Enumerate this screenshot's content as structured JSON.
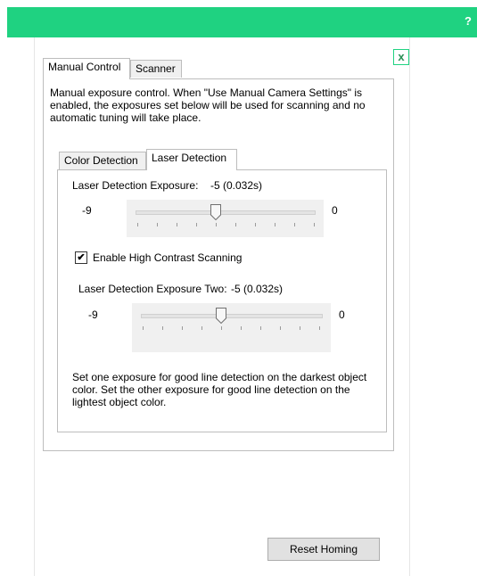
{
  "header": {
    "help_label": "?"
  },
  "dialog": {
    "close_label": "x"
  },
  "tabs": [
    {
      "label": "Manual Control",
      "active": true
    },
    {
      "label": "Scanner",
      "active": false
    }
  ],
  "manual_control": {
    "description": "Manual exposure control. When \"Use Manual Camera Settings\" is enabled, the exposures set below will be used for scanning and no automatic tuning will take place.",
    "inner_tabs": [
      {
        "label": "Color Detection",
        "active": false
      },
      {
        "label": "Laser Detection",
        "active": true
      }
    ],
    "laser": {
      "exposure_label": "Laser Detection Exposure:",
      "exposure_value": "-5 (0.032s)",
      "slider1": {
        "min_label": "-9",
        "max_label": "0",
        "value": -5,
        "min": -9,
        "max": 0
      },
      "high_contrast_label": "Enable High Contrast Scanning",
      "high_contrast_checked": true,
      "exposure_two_label": "Laser Detection Exposure Two:",
      "exposure_two_value": "-5 (0.032s)",
      "slider2": {
        "min_label": "-9",
        "max_label": "0",
        "value": -5,
        "min": -9,
        "max": 0
      },
      "help_text": "Set one exposure for good line detection on the darkest object color. Set the other exposure for good line detection on the lightest object color."
    }
  },
  "actions": {
    "reset_homing": "Reset Homing"
  },
  "colors": {
    "accent": "#1fd281",
    "close_border": "#1fd281"
  }
}
